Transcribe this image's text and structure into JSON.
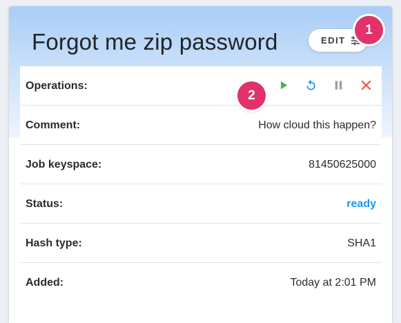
{
  "header": {
    "title": "Forgot me zip password",
    "edit_label": "EDIT"
  },
  "badges": [
    "1",
    "2"
  ],
  "details": {
    "operations_label": "Operations:",
    "operations_icons": [
      "play-icon",
      "restart-icon",
      "pause-icon",
      "delete-icon"
    ],
    "rows": [
      {
        "label": "Comment:",
        "value": "How cloud this happen?"
      },
      {
        "label": "Job keyspace:",
        "value": "81450625000"
      },
      {
        "label": "Status:",
        "value": "ready"
      },
      {
        "label": "Hash type:",
        "value": "SHA1"
      },
      {
        "label": "Added:",
        "value": "Today at 2:01 PM"
      }
    ]
  },
  "colors": {
    "play": "#4caf50",
    "restart": "#2196f3",
    "pause": "#9e9e9e",
    "delete": "#f44336",
    "status": "#2196f3",
    "badge": "#e0336a"
  }
}
